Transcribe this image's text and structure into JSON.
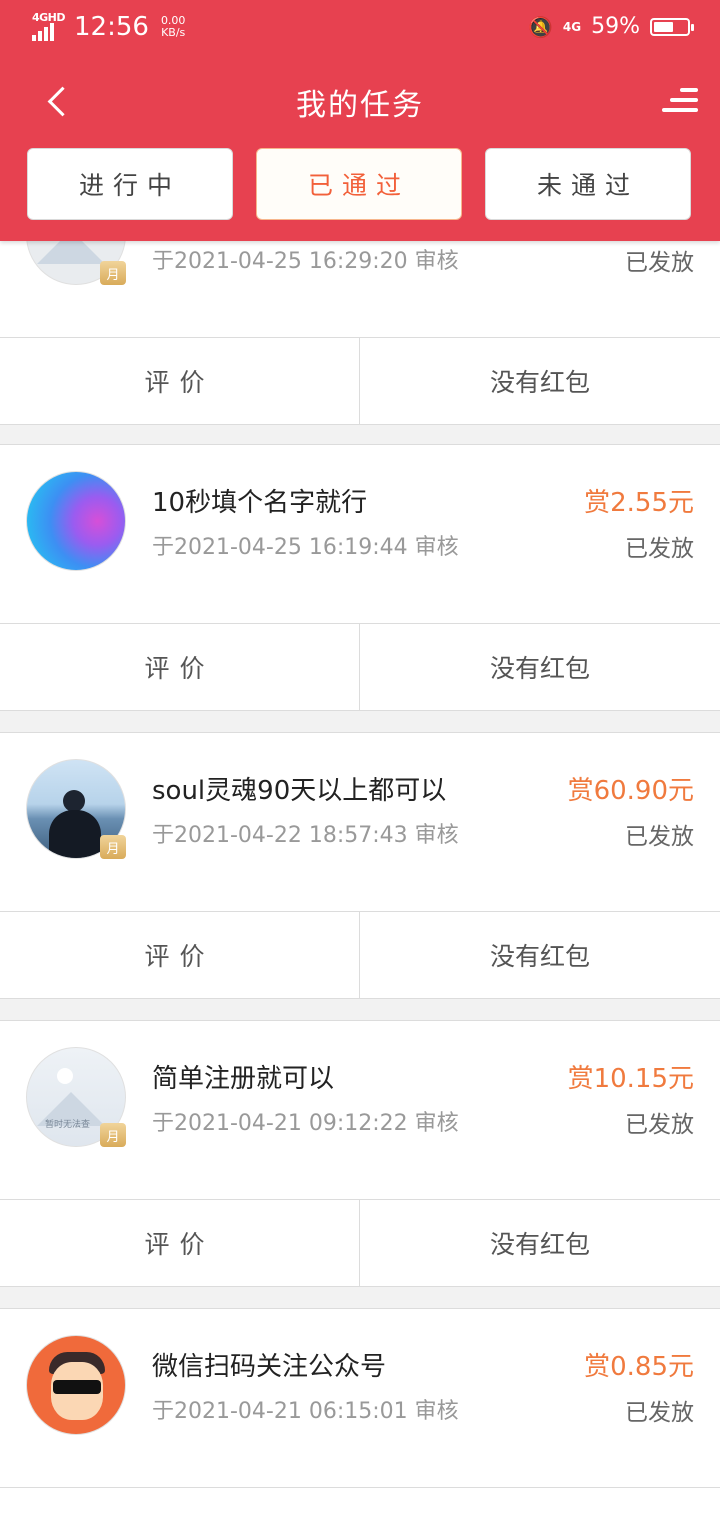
{
  "status_bar": {
    "network_left": "4GHD",
    "time": "12:56",
    "speed_value": "0.00",
    "speed_unit": "KB/s",
    "network_right": "4G",
    "battery": "59%",
    "battery_level": 0.59
  },
  "header": {
    "title": "我的任务"
  },
  "tabs": [
    {
      "label": "进行中",
      "active": false
    },
    {
      "label": "已通过",
      "active": true
    },
    {
      "label": "未通过",
      "active": false
    }
  ],
  "tasks": [
    {
      "title": "",
      "time": "于2021-04-25 16:29:20 审核",
      "reward": "",
      "status": "已发放",
      "avatar": "qr-image",
      "badge": "月",
      "review": "评价",
      "redpacket": "没有红包"
    },
    {
      "title": "10秒填个名字就行",
      "time": "于2021-04-25 16:19:44 审核",
      "reward": "赏2.55元",
      "status": "已发放",
      "avatar": "gradient-orb",
      "badge": "",
      "review": "评价",
      "redpacket": "没有红包"
    },
    {
      "title": "soul灵魂90天以上都可以",
      "time": "于2021-04-22 18:57:43 审核",
      "reward": "赏60.90元",
      "status": "已发放",
      "avatar": "person-at-sea",
      "badge": "月",
      "review": "评价",
      "redpacket": "没有红包"
    },
    {
      "title": "简单注册就可以",
      "time": "于2021-04-21 09:12:22 审核",
      "reward": "赏10.15元",
      "status": "已发放",
      "avatar": "image-placeholder",
      "avatar_text": "暂时无法查",
      "badge": "月",
      "review": "评价",
      "redpacket": "没有红包"
    },
    {
      "title": "微信扫码关注公众号",
      "time": "于2021-04-21 06:15:01 审核",
      "reward": "赏0.85元",
      "status": "已发放",
      "avatar": "cartoon-man",
      "badge": "",
      "review": "",
      "redpacket": ""
    }
  ]
}
